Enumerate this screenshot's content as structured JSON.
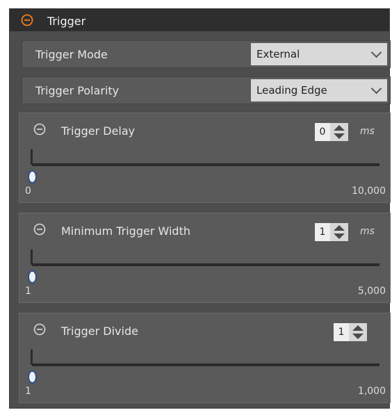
{
  "header": {
    "title": "Trigger"
  },
  "trigger_mode": {
    "label": "Trigger Mode",
    "value": "External"
  },
  "trigger_polarity": {
    "label": "Trigger Polarity",
    "value": "Leading Edge"
  },
  "trigger_delay": {
    "title": "Trigger Delay",
    "value": "0",
    "unit": "ms",
    "min": "0",
    "max": "10,000",
    "level": 0
  },
  "min_trigger_width": {
    "title": "Minimum Trigger Width",
    "value": "1",
    "unit": "ms",
    "min": "1",
    "max": "5,000",
    "level": 0
  },
  "trigger_divide": {
    "title": "Trigger Divide",
    "value": "1",
    "min": "1",
    "max": "1,000",
    "level": 0
  },
  "colors": {
    "accent": "#f07d1b",
    "panel_bg": "#4d4d4d",
    "header_bg": "#2e2e2e",
    "thumb_border": "#2c4f8f"
  }
}
